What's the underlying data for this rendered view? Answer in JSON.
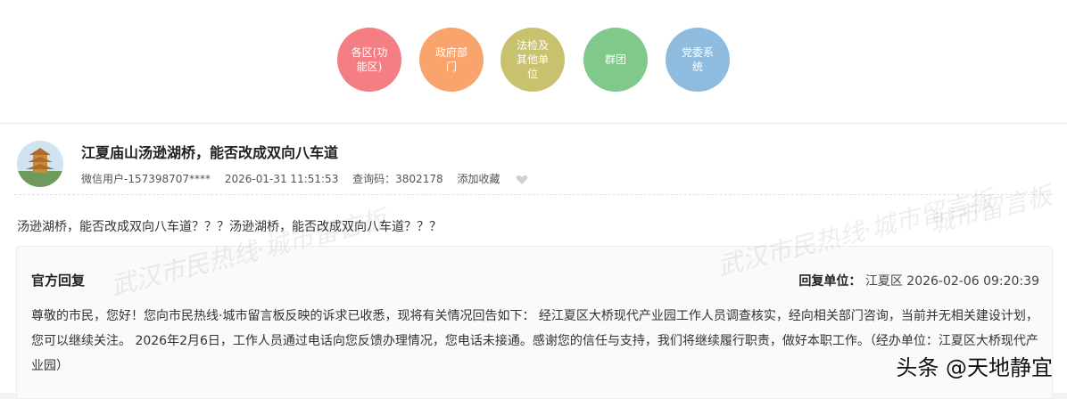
{
  "categories": [
    {
      "label": "各区(功能区)",
      "color": "#f47e84"
    },
    {
      "label": "政府部门",
      "color": "#f9a46d"
    },
    {
      "label": "法检及其他单位",
      "color": "#c8c26f"
    },
    {
      "label": "群团",
      "color": "#80c98b"
    },
    {
      "label": "党委系统",
      "color": "#8fbcde"
    }
  ],
  "post": {
    "title": "江夏庙山汤逊湖桥，能否改成双向八车道",
    "user": "微信用户-157398707****",
    "datetime": "2026-01-31 11:51:53",
    "query_code": "查询码：3802178",
    "favorite": "添加收藏",
    "content": "汤逊湖桥，能否改成双向八车道？？？汤逊湖桥，能否改成双向八车道？？？"
  },
  "reply": {
    "title": "官方回复",
    "unit_label": "回复单位：",
    "unit": "江夏区",
    "datetime": "2026-02-06 09:20:39",
    "text": "尊敬的市民，您好！您向市民热线·城市留言板反映的诉求已收悉，现将有关情况回告如下： 经江夏区大桥现代产业园工作人员调查核实，经向相关部门咨询，当前并无相关建设计划，您可以继续关注。 2026年2月6日，工作人员通过电话向您反馈办理情况，您电话未接通。感谢您的信任与支持，我们将继续履行职责，做好本职工作。（经办单位：江夏区大桥现代产业园）"
  },
  "watermarks": [
    "武汉市民热线·城市留言板",
    "武汉市民热线·城市留言板",
    "城市留言板"
  ],
  "attribution": "头条 @天地静宜"
}
